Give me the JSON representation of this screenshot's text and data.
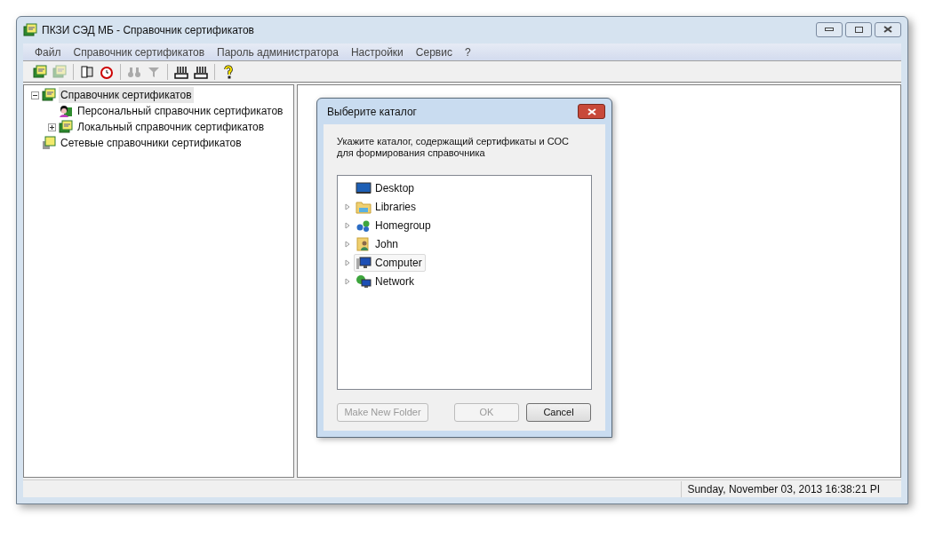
{
  "window": {
    "title": "ПКЗИ СЭД МБ - Справочник сертификатов"
  },
  "menu": [
    "Файл",
    "Справочник сертификатов",
    "Пароль администратора",
    "Настройки",
    "Сервис",
    "?"
  ],
  "toolbar": [
    {
      "kind": "certificate",
      "disabled": false
    },
    {
      "kind": "certificate",
      "disabled": true
    },
    {
      "kind": "separator"
    },
    {
      "kind": "book",
      "disabled": false
    },
    {
      "kind": "alarm",
      "disabled": false
    },
    {
      "kind": "separator"
    },
    {
      "kind": "binoculars",
      "disabled": true
    },
    {
      "kind": "filter",
      "disabled": true
    },
    {
      "kind": "separator"
    },
    {
      "kind": "tray",
      "disabled": false
    },
    {
      "kind": "tray",
      "disabled": false
    },
    {
      "kind": "separator"
    },
    {
      "kind": "help",
      "disabled": false
    }
  ],
  "tree": [
    {
      "label": "Справочник сертификатов",
      "kind": "folder",
      "selected": true,
      "expanded": true,
      "children": [
        {
          "label": "Персональный справочник сертификатов",
          "kind": "person",
          "selected": false
        },
        {
          "label": "Локальный справочник сертификатов",
          "kind": "folder",
          "selected": false,
          "expanded": false
        }
      ]
    },
    {
      "label": "Сетевые справочники сертификатов",
      "kind": "network",
      "selected": false
    }
  ],
  "dialog": {
    "title": "Выберите каталог",
    "prompt": [
      "Укажите каталог, содержащий сертификаты и СОС",
      "для формирования справочника"
    ],
    "folders": [
      {
        "label": "Desktop",
        "kind": "desktop",
        "expandable": false,
        "selected": false
      },
      {
        "label": "Libraries",
        "kind": "libraries",
        "expandable": true,
        "selected": false
      },
      {
        "label": "Homegroup",
        "kind": "homegroup",
        "expandable": true,
        "selected": false
      },
      {
        "label": "John",
        "kind": "user",
        "expandable": true,
        "selected": false
      },
      {
        "label": "Computer",
        "kind": "computer",
        "expandable": true,
        "selected": true
      },
      {
        "label": "Network",
        "kind": "network",
        "expandable": true,
        "selected": false
      }
    ],
    "buttons": [
      {
        "label": "Make New Folder",
        "disabled": true
      },
      {
        "label": "OK",
        "disabled": true
      },
      {
        "label": "Cancel",
        "disabled": false
      }
    ]
  },
  "status_bar": {
    "datetime": "Sunday, November 03, 2013 16:38:21 PI"
  }
}
